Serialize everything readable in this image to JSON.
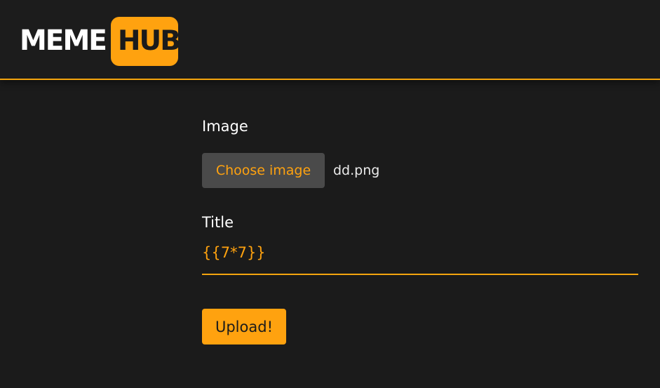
{
  "header": {
    "logo_part1": "MEME",
    "logo_part2": "HUB"
  },
  "form": {
    "image_label": "Image",
    "choose_button_label": "Choose image",
    "file_name": "dd.png",
    "title_label": "Title",
    "title_value": "{{7*7}}",
    "upload_button_label": "Upload!"
  },
  "colors": {
    "accent": "#ffa20f",
    "background": "#1b1b1b",
    "button_gray": "#4a4a4a",
    "text": "#ffffff"
  }
}
